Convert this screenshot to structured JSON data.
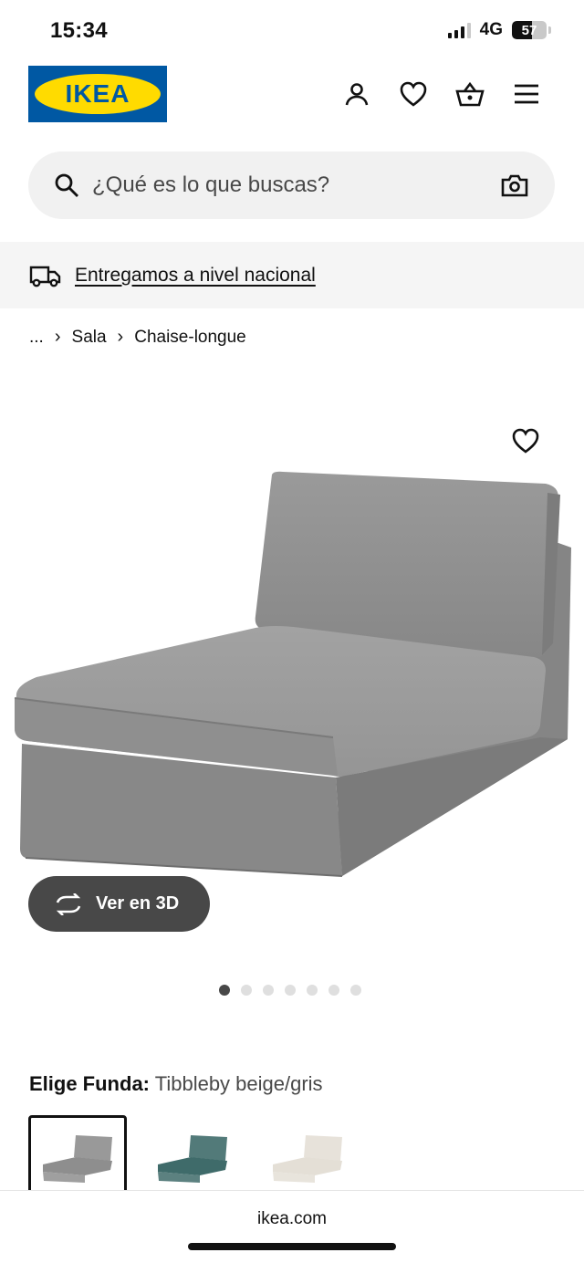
{
  "status_bar": {
    "time": "15:34",
    "network": "4G",
    "battery_level": "57",
    "battery_fraction": 0.57
  },
  "header": {
    "logo_text": "IKEA",
    "icons": [
      "account-icon",
      "heart-icon",
      "basket-icon",
      "menu-icon"
    ]
  },
  "search": {
    "placeholder": "¿Qué es lo que buscas?"
  },
  "delivery": {
    "text": "Entregamos a nivel nacional"
  },
  "breadcrumb": {
    "items": [
      "...",
      "Sala",
      "Chaise-longue"
    ]
  },
  "product": {
    "view3d_label": "Ver en 3D",
    "image_count": 7,
    "active_image": 1
  },
  "variant": {
    "label": "Elige Funda:",
    "value": "Tibbleby beige/gris",
    "swatches": [
      {
        "color": "#8e8e8e",
        "selected": true
      },
      {
        "color": "#3f6b6a",
        "selected": false
      },
      {
        "color": "#e4dfd6",
        "selected": false
      }
    ]
  },
  "browser": {
    "url": "ikea.com"
  }
}
